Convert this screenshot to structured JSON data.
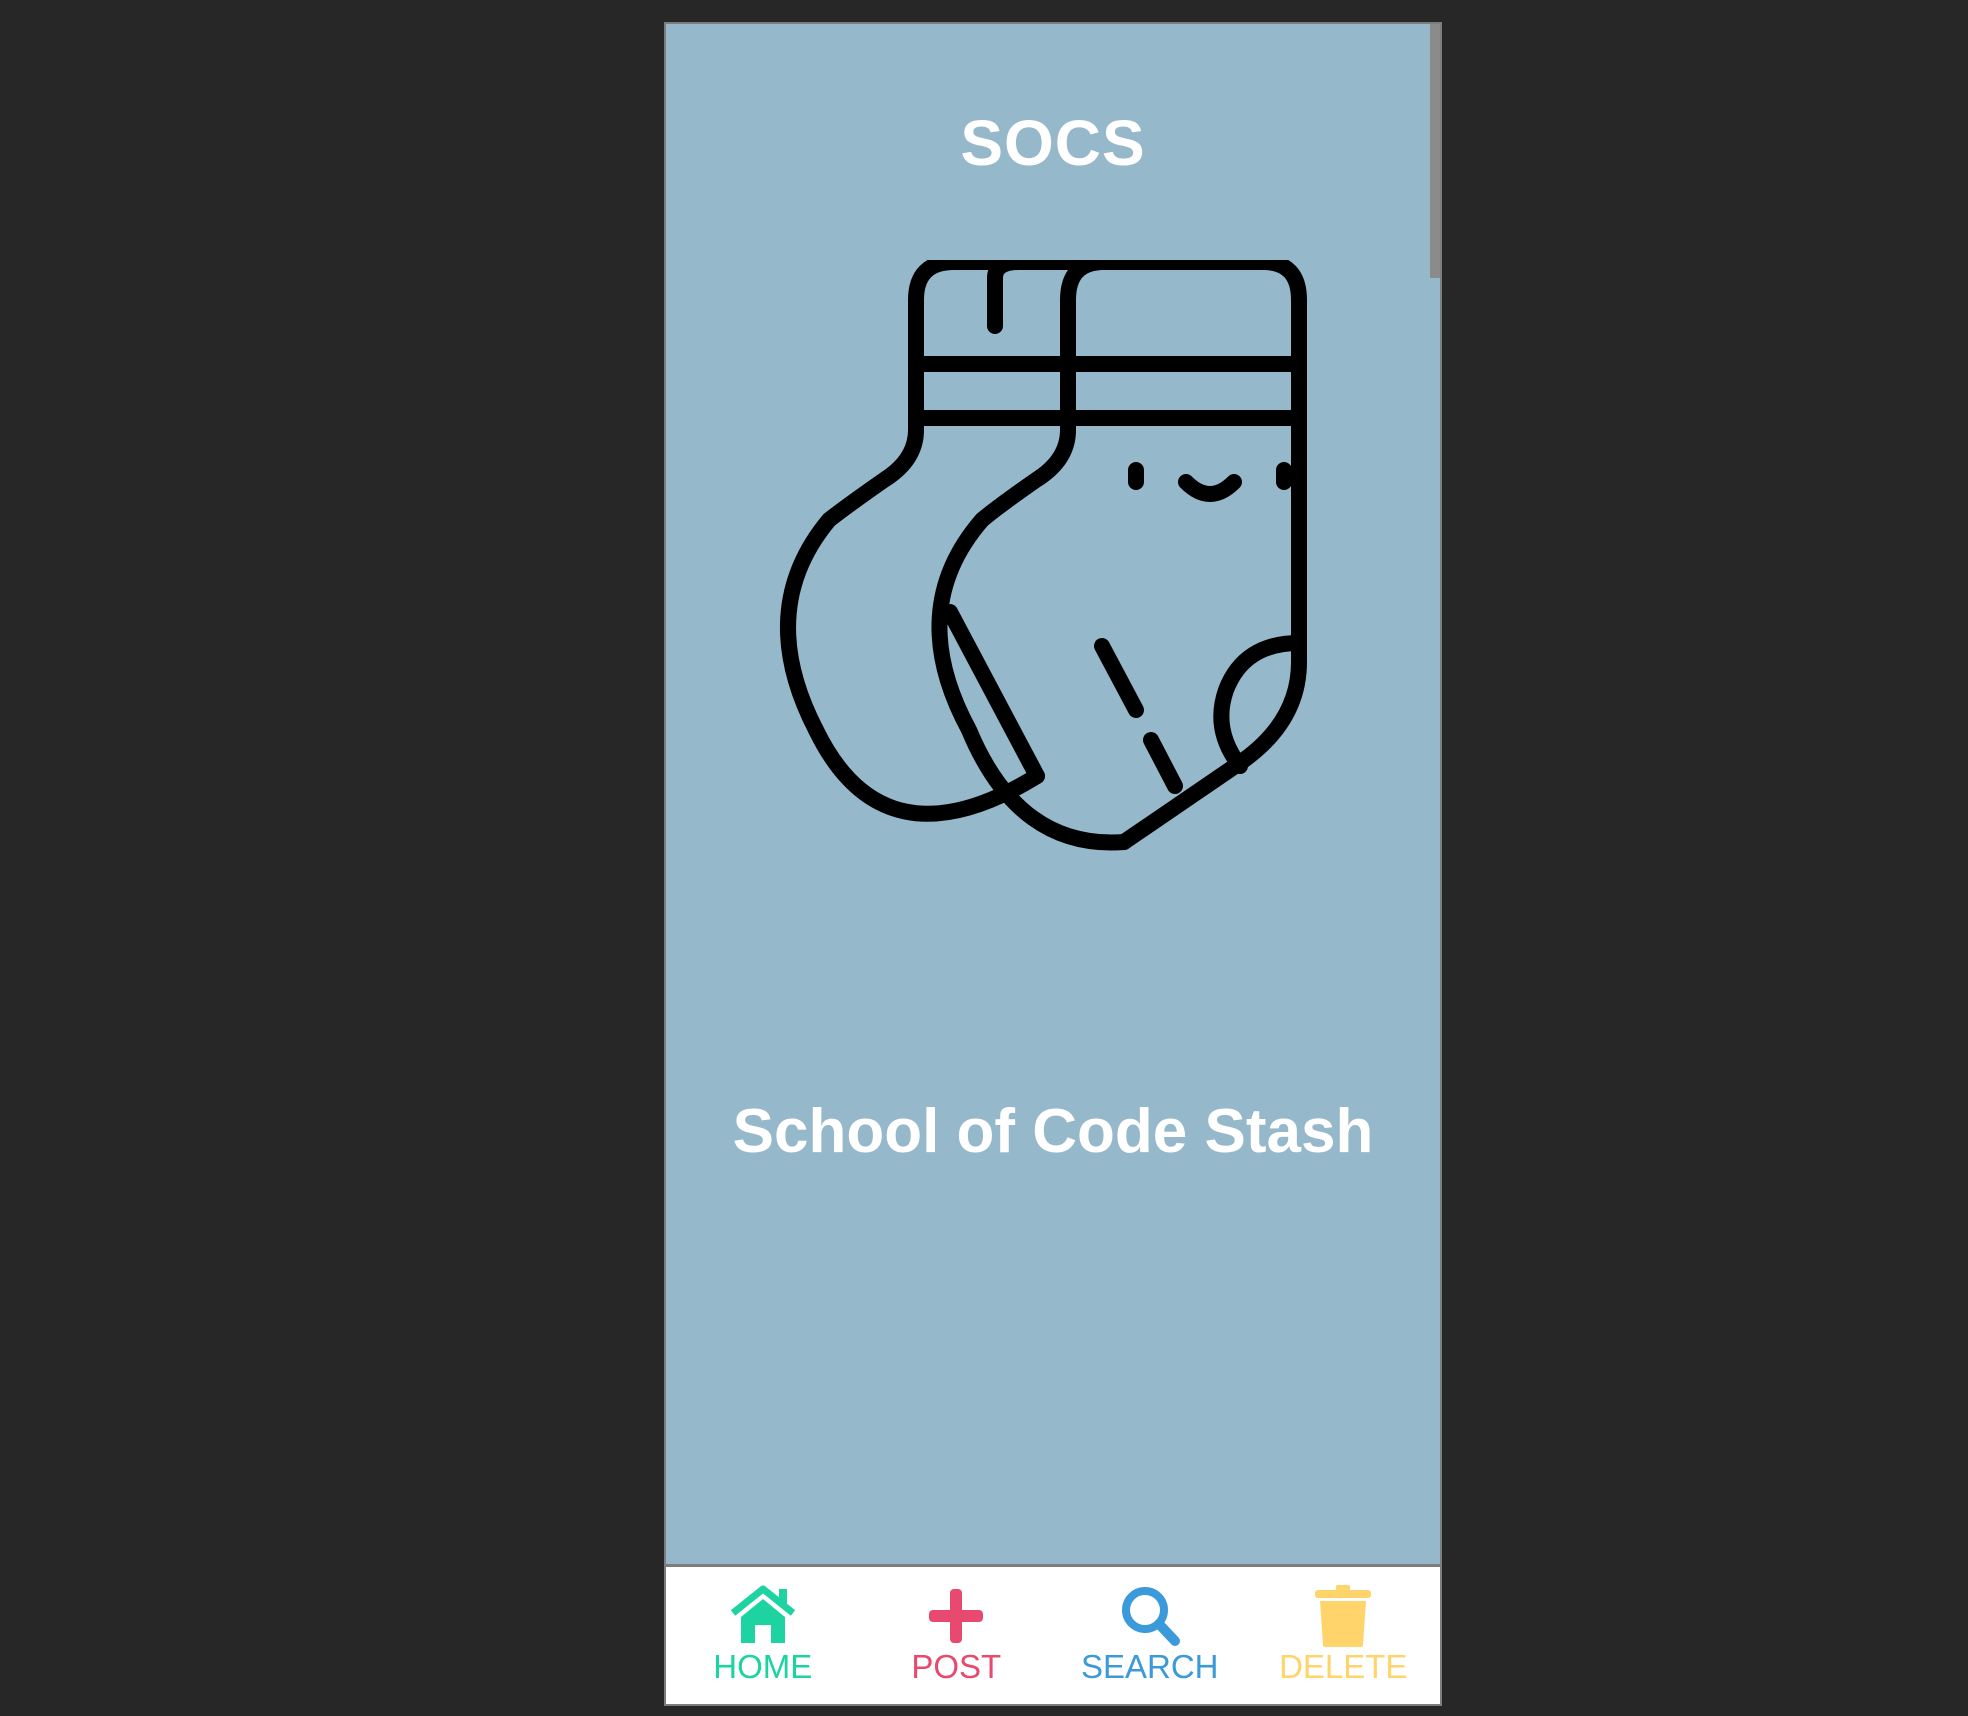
{
  "app": {
    "title": "SOCS",
    "tagline": "School of Code Stash",
    "background_color": "#96b8cb",
    "illustration": "socks-icon"
  },
  "nav": {
    "items": [
      {
        "label": "HOME",
        "icon": "home-icon",
        "color": "#1dd3a1"
      },
      {
        "label": "POST",
        "icon": "plus-icon",
        "color": "#e84a6f"
      },
      {
        "label": "SEARCH",
        "icon": "search-icon",
        "color": "#3b9ad9"
      },
      {
        "label": "DELETE",
        "icon": "trash-icon",
        "color": "#ffd56b"
      }
    ]
  }
}
